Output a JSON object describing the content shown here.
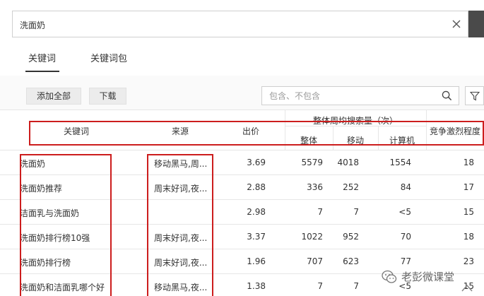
{
  "search": {
    "query": "洗面奶"
  },
  "tabs": [
    {
      "label": "关键词",
      "active": true
    },
    {
      "label": "关键词包",
      "active": false
    }
  ],
  "toolbar": {
    "add_all_label": "添加全部",
    "download_label": "下载",
    "filter_placeholder": "包含、不包含"
  },
  "table": {
    "group_header": "整体周均搜索量（次）",
    "columns": {
      "keyword": "关键词",
      "source": "来源",
      "bid": "出价",
      "total": "整体",
      "mobile": "移动",
      "computer": "计算机",
      "competition": "竞争激烈程度"
    },
    "rows": [
      {
        "keyword": "洗面奶",
        "source": "移动黑马,周...",
        "bid": "3.69",
        "total": "5579",
        "mobile": "4018",
        "computer": "1554",
        "competition": "18"
      },
      {
        "keyword": "洗面奶推荐",
        "source": "周末好词,夜...",
        "bid": "2.88",
        "total": "336",
        "mobile": "252",
        "computer": "84",
        "competition": "17"
      },
      {
        "keyword": "洁面乳与洗面奶",
        "source": "",
        "bid": "2.98",
        "total": "7",
        "mobile": "7",
        "computer": "<5",
        "competition": "15"
      },
      {
        "keyword": "洗面奶排行榜10强",
        "source": "周末好词,夜...",
        "bid": "3.37",
        "total": "1022",
        "mobile": "952",
        "computer": "70",
        "competition": "18"
      },
      {
        "keyword": "洗面奶排行榜",
        "source": "周末好词,夜...",
        "bid": "1.96",
        "total": "707",
        "mobile": "623",
        "computer": "77",
        "competition": "23"
      },
      {
        "keyword": "洗面奶和洁面乳哪个好",
        "source": "移动黑马,夜...",
        "bid": "1.38",
        "total": "7",
        "mobile": "7",
        "computer": "<5",
        "competition": "15"
      }
    ]
  },
  "watermark": {
    "text": "老彭微课堂"
  }
}
